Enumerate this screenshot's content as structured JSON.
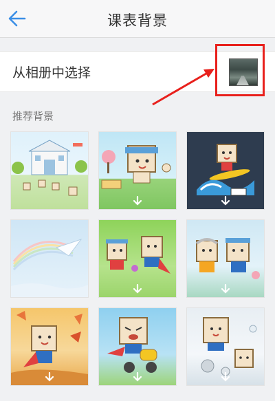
{
  "header": {
    "title": "课表背景",
    "back_icon": "arrow-left-icon"
  },
  "album": {
    "label": "从相册中选择"
  },
  "section": {
    "label": "推荐背景"
  },
  "colors": {
    "accent_blue": "#3a8ee6",
    "highlight_red": "#e8201c",
    "download_arrow": "#ffffff"
  },
  "backgrounds": [
    {
      "name": "school-building",
      "download_icon": "download-arrow-icon"
    },
    {
      "name": "cartoon-sign",
      "download_icon": "download-arrow-icon"
    },
    {
      "name": "surfing-dark",
      "download_icon": "download-arrow-icon"
    },
    {
      "name": "rainbow-sky",
      "download_icon": ""
    },
    {
      "name": "superhero-duo",
      "download_icon": "download-arrow-icon"
    },
    {
      "name": "grandparents",
      "download_icon": "download-arrow-icon"
    },
    {
      "name": "autumn-leaves",
      "download_icon": "download-arrow-icon"
    },
    {
      "name": "scooter-ride",
      "download_icon": "download-arrow-icon"
    },
    {
      "name": "bath-time",
      "download_icon": "download-arrow-icon"
    }
  ]
}
